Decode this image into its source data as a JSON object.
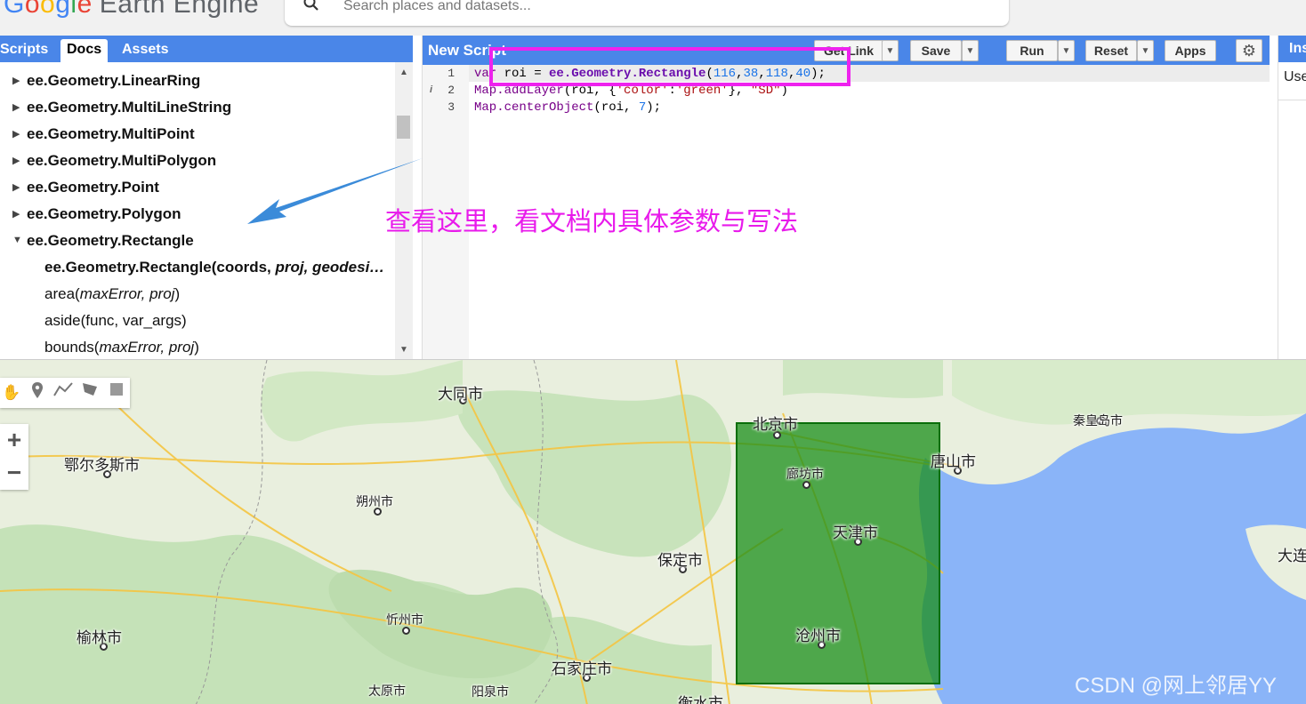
{
  "app": {
    "logo_g1": "G",
    "logo_g2": "o",
    "logo_g3": "o",
    "logo_g4": "g",
    "logo_g5": "l",
    "logo_g6": "e",
    "logo_rest": "Earth Engine"
  },
  "search": {
    "placeholder": "Search places and datasets...",
    "icon": "search-icon"
  },
  "left_tabs": [
    "Scripts",
    "Docs",
    "Assets"
  ],
  "docs": {
    "groups": [
      "ee.Geometry.LinearRing",
      "ee.Geometry.MultiLineString",
      "ee.Geometry.MultiPoint",
      "ee.Geometry.MultiPolygon",
      "ee.Geometry.Point",
      "ee.Geometry.Polygon",
      "ee.Geometry.Rectangle"
    ],
    "methods": [
      {
        "name": "ee.Geometry.Rectangle(coords, ",
        "args": "proj, geodesi…"
      },
      {
        "name": "area(",
        "args": "maxError, proj",
        "close": ")"
      },
      {
        "name": "aside(func, var_args)",
        "args": "",
        "close": ""
      },
      {
        "name": "bounds(",
        "args": "maxError, proj",
        "close": ")"
      }
    ]
  },
  "editor": {
    "script_name": "New Script",
    "buttons": {
      "get_link": "Get Link",
      "save": "Save",
      "run": "Run",
      "reset": "Reset",
      "apps": "Apps"
    },
    "line_numbers": [
      "1",
      "2",
      "3"
    ],
    "info_mark": "i",
    "code": {
      "l1_var": "var",
      "l1_a": " roi = ",
      "l1_fn": "ee.Geometry.Rectangle",
      "l1_open": "(",
      "l1_n1": "116",
      "l1_n2": "38",
      "l1_n3": "118",
      "l1_n4": "40",
      "l1_close": ");",
      "l2_fn": "Map.addLayer",
      "l2_a": "(roi, {",
      "l2_s1": "'color'",
      "l2_colon": ":",
      "l2_s2": "'green'",
      "l2_b": "}, ",
      "l2_s3": "\"SD\"",
      "l2_close": ")",
      "l3_fn": "Map.centerObject",
      "l3_a": "(roi, ",
      "l3_n": "7",
      "l3_close": ");"
    }
  },
  "annotation": {
    "text": "查看这里，看文档内具体参数与写法",
    "color": "#e81aeb"
  },
  "right_panel": {
    "tab": "Ins",
    "text": "Use"
  },
  "map": {
    "cities": [
      {
        "name": "大同市"
      },
      {
        "name": "北京市"
      },
      {
        "name": "秦皇岛市"
      },
      {
        "name": "鄂尔多斯市"
      },
      {
        "name": "廊坊市"
      },
      {
        "name": "唐山市"
      },
      {
        "name": "朔州市"
      },
      {
        "name": "天津市"
      },
      {
        "name": "保定市"
      },
      {
        "name": "大连"
      },
      {
        "name": "忻州市"
      },
      {
        "name": "榆林市"
      },
      {
        "name": "沧州市"
      },
      {
        "name": "石家庄市"
      },
      {
        "name": "太原市"
      },
      {
        "name": "阳泉市"
      },
      {
        "name": "衡水市"
      }
    ],
    "geometry_color": "#1a8f1a",
    "zoom_in": "+",
    "zoom_out": "−"
  },
  "watermark": "CSDN @网上邻居YY"
}
